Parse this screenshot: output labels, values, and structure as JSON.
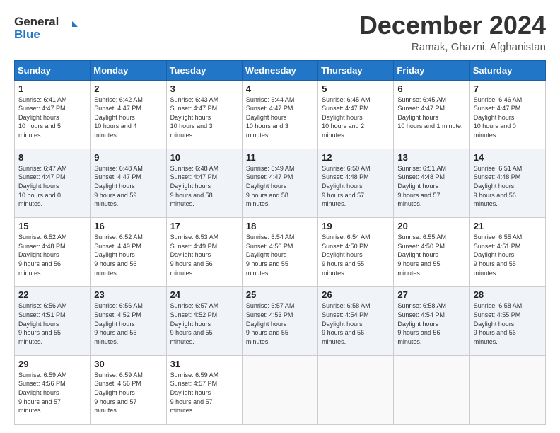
{
  "header": {
    "logo_line1": "General",
    "logo_line2": "Blue",
    "month": "December 2024",
    "location": "Ramak, Ghazni, Afghanistan"
  },
  "weekdays": [
    "Sunday",
    "Monday",
    "Tuesday",
    "Wednesday",
    "Thursday",
    "Friday",
    "Saturday"
  ],
  "weeks": [
    [
      {
        "day": "1",
        "sunrise": "6:41 AM",
        "sunset": "4:47 PM",
        "daylight": "10 hours and 5 minutes."
      },
      {
        "day": "2",
        "sunrise": "6:42 AM",
        "sunset": "4:47 PM",
        "daylight": "10 hours and 4 minutes."
      },
      {
        "day": "3",
        "sunrise": "6:43 AM",
        "sunset": "4:47 PM",
        "daylight": "10 hours and 3 minutes."
      },
      {
        "day": "4",
        "sunrise": "6:44 AM",
        "sunset": "4:47 PM",
        "daylight": "10 hours and 3 minutes."
      },
      {
        "day": "5",
        "sunrise": "6:45 AM",
        "sunset": "4:47 PM",
        "daylight": "10 hours and 2 minutes."
      },
      {
        "day": "6",
        "sunrise": "6:45 AM",
        "sunset": "4:47 PM",
        "daylight": "10 hours and 1 minute."
      },
      {
        "day": "7",
        "sunrise": "6:46 AM",
        "sunset": "4:47 PM",
        "daylight": "10 hours and 0 minutes."
      }
    ],
    [
      {
        "day": "8",
        "sunrise": "6:47 AM",
        "sunset": "4:47 PM",
        "daylight": "10 hours and 0 minutes."
      },
      {
        "day": "9",
        "sunrise": "6:48 AM",
        "sunset": "4:47 PM",
        "daylight": "9 hours and 59 minutes."
      },
      {
        "day": "10",
        "sunrise": "6:48 AM",
        "sunset": "4:47 PM",
        "daylight": "9 hours and 58 minutes."
      },
      {
        "day": "11",
        "sunrise": "6:49 AM",
        "sunset": "4:47 PM",
        "daylight": "9 hours and 58 minutes."
      },
      {
        "day": "12",
        "sunrise": "6:50 AM",
        "sunset": "4:48 PM",
        "daylight": "9 hours and 57 minutes."
      },
      {
        "day": "13",
        "sunrise": "6:51 AM",
        "sunset": "4:48 PM",
        "daylight": "9 hours and 57 minutes."
      },
      {
        "day": "14",
        "sunrise": "6:51 AM",
        "sunset": "4:48 PM",
        "daylight": "9 hours and 56 minutes."
      }
    ],
    [
      {
        "day": "15",
        "sunrise": "6:52 AM",
        "sunset": "4:48 PM",
        "daylight": "9 hours and 56 minutes."
      },
      {
        "day": "16",
        "sunrise": "6:52 AM",
        "sunset": "4:49 PM",
        "daylight": "9 hours and 56 minutes."
      },
      {
        "day": "17",
        "sunrise": "6:53 AM",
        "sunset": "4:49 PM",
        "daylight": "9 hours and 56 minutes."
      },
      {
        "day": "18",
        "sunrise": "6:54 AM",
        "sunset": "4:50 PM",
        "daylight": "9 hours and 55 minutes."
      },
      {
        "day": "19",
        "sunrise": "6:54 AM",
        "sunset": "4:50 PM",
        "daylight": "9 hours and 55 minutes."
      },
      {
        "day": "20",
        "sunrise": "6:55 AM",
        "sunset": "4:50 PM",
        "daylight": "9 hours and 55 minutes."
      },
      {
        "day": "21",
        "sunrise": "6:55 AM",
        "sunset": "4:51 PM",
        "daylight": "9 hours and 55 minutes."
      }
    ],
    [
      {
        "day": "22",
        "sunrise": "6:56 AM",
        "sunset": "4:51 PM",
        "daylight": "9 hours and 55 minutes."
      },
      {
        "day": "23",
        "sunrise": "6:56 AM",
        "sunset": "4:52 PM",
        "daylight": "9 hours and 55 minutes."
      },
      {
        "day": "24",
        "sunrise": "6:57 AM",
        "sunset": "4:52 PM",
        "daylight": "9 hours and 55 minutes."
      },
      {
        "day": "25",
        "sunrise": "6:57 AM",
        "sunset": "4:53 PM",
        "daylight": "9 hours and 55 minutes."
      },
      {
        "day": "26",
        "sunrise": "6:58 AM",
        "sunset": "4:54 PM",
        "daylight": "9 hours and 56 minutes."
      },
      {
        "day": "27",
        "sunrise": "6:58 AM",
        "sunset": "4:54 PM",
        "daylight": "9 hours and 56 minutes."
      },
      {
        "day": "28",
        "sunrise": "6:58 AM",
        "sunset": "4:55 PM",
        "daylight": "9 hours and 56 minutes."
      }
    ],
    [
      {
        "day": "29",
        "sunrise": "6:59 AM",
        "sunset": "4:56 PM",
        "daylight": "9 hours and 57 minutes."
      },
      {
        "day": "30",
        "sunrise": "6:59 AM",
        "sunset": "4:56 PM",
        "daylight": "9 hours and 57 minutes."
      },
      {
        "day": "31",
        "sunrise": "6:59 AM",
        "sunset": "4:57 PM",
        "daylight": "9 hours and 57 minutes."
      },
      null,
      null,
      null,
      null
    ]
  ]
}
